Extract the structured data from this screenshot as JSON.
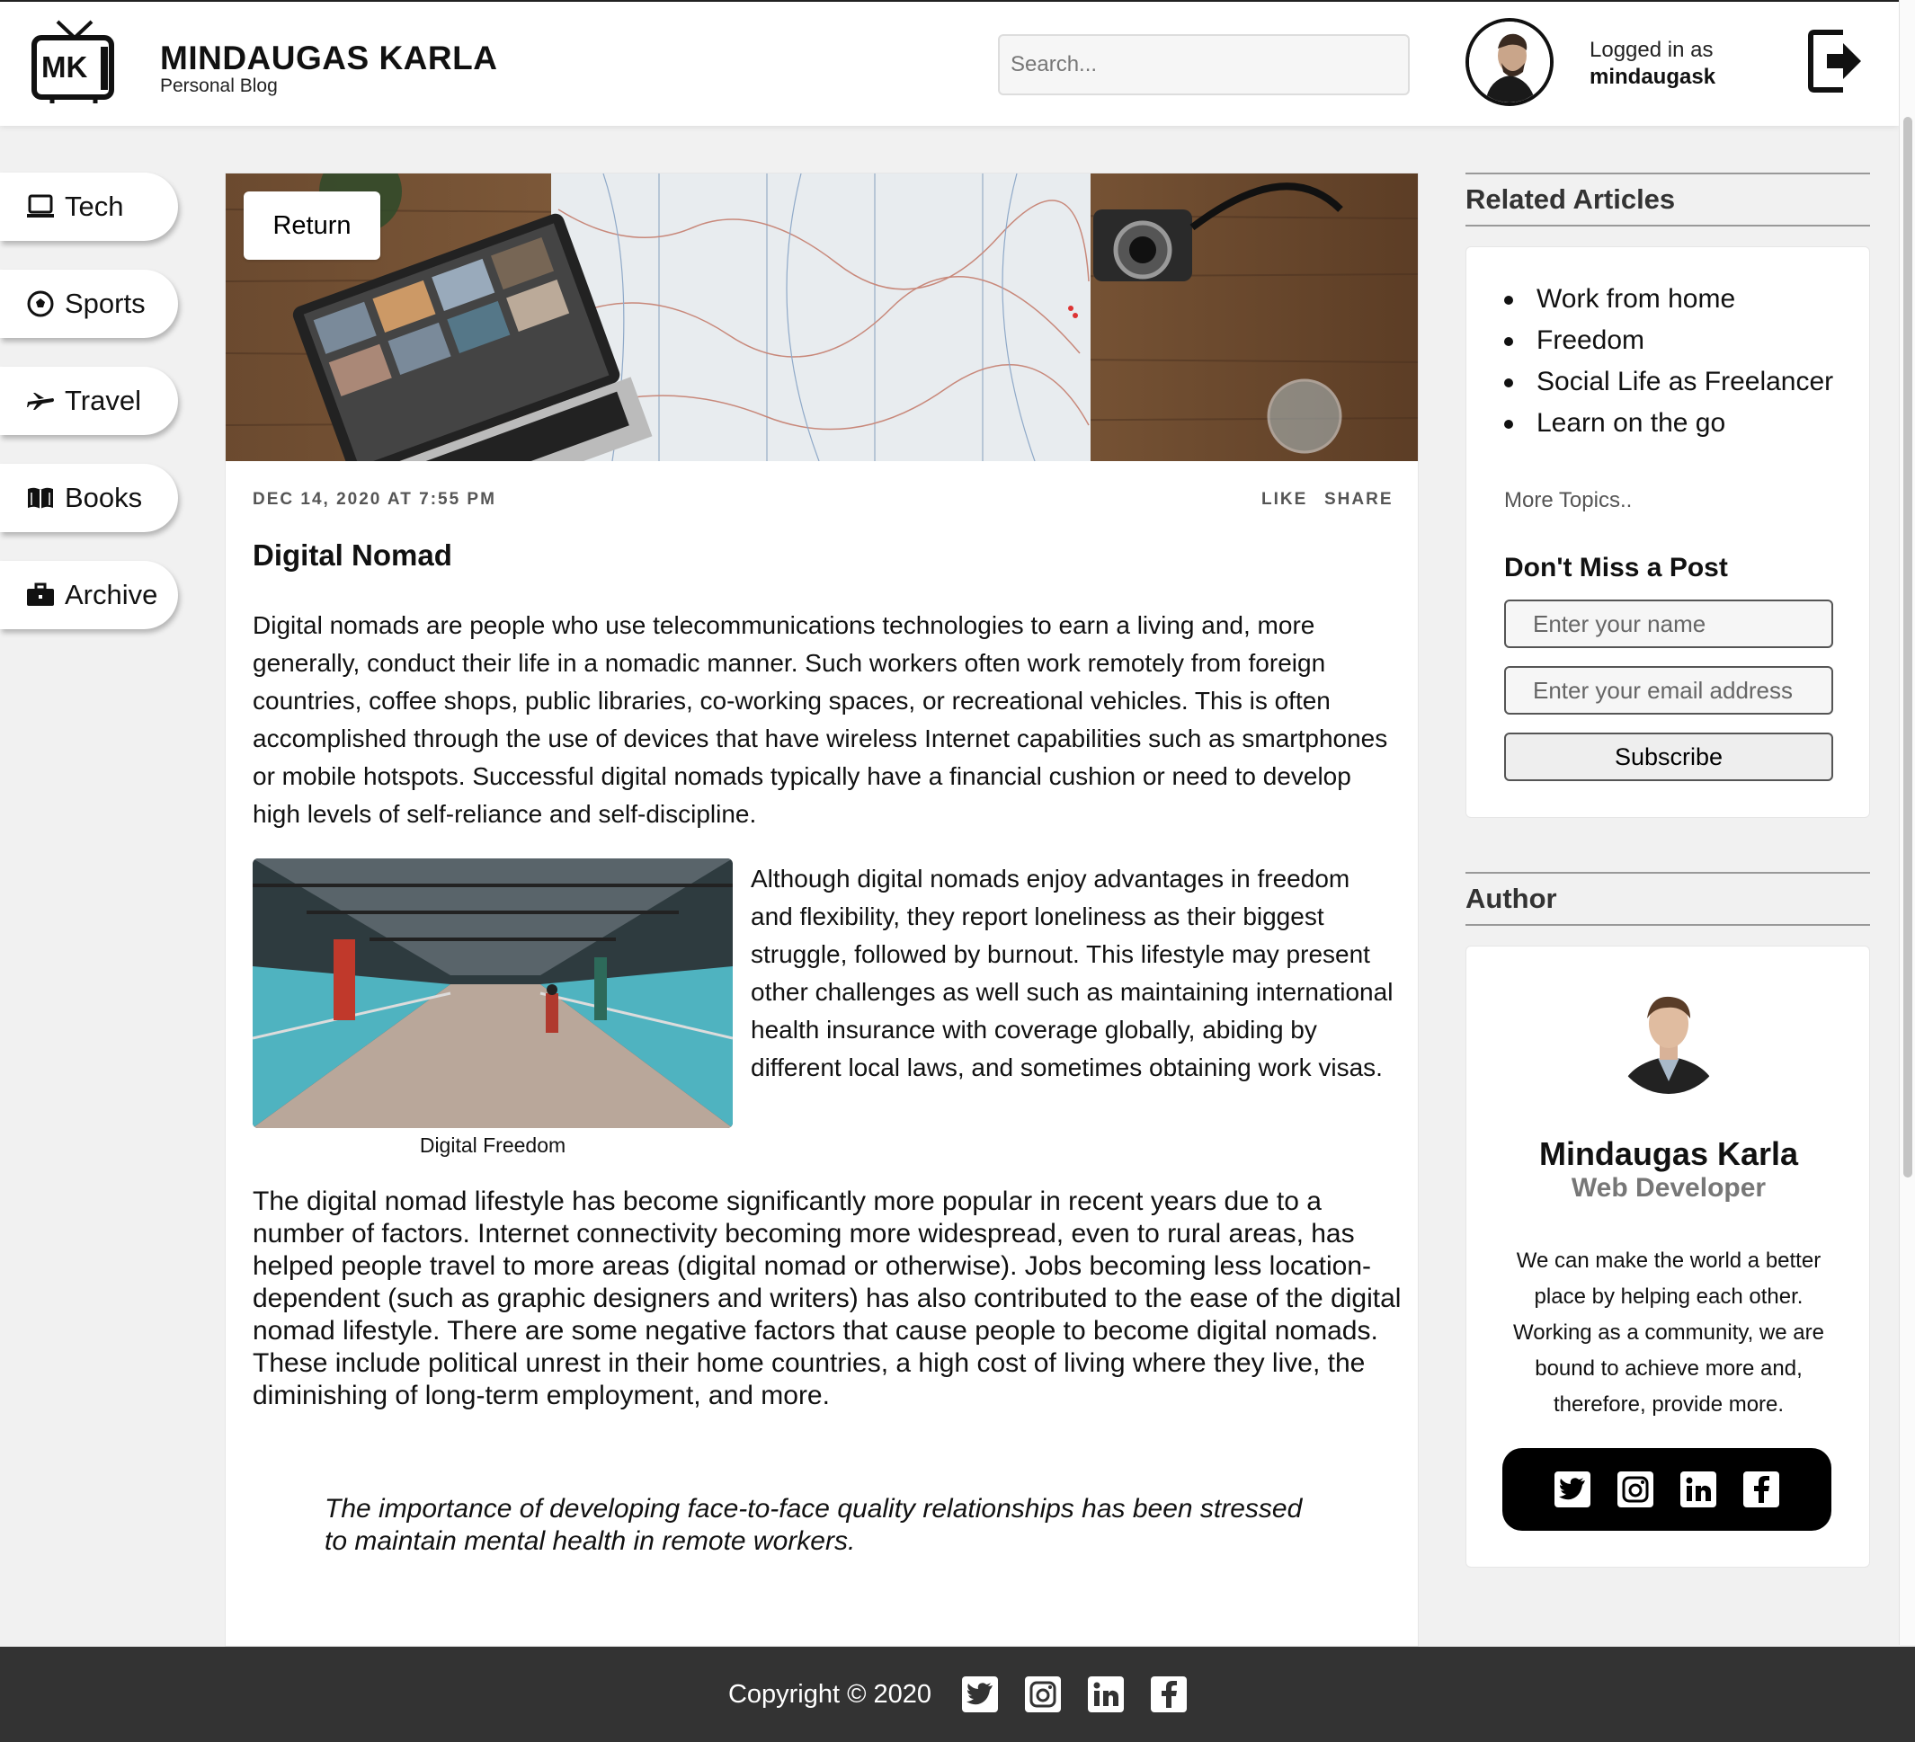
{
  "header": {
    "logo_text": "MK",
    "brand_title": "MINDAUGAS KARLA",
    "brand_subtitle": "Personal Blog",
    "search_placeholder": "Search...",
    "logged_in_label": "Logged in as",
    "username": "mindaugask"
  },
  "nav": {
    "items": [
      {
        "label": "Tech",
        "icon": "laptop-icon"
      },
      {
        "label": "Sports",
        "icon": "soccer-ball-icon"
      },
      {
        "label": "Travel",
        "icon": "plane-icon"
      },
      {
        "label": "Books",
        "icon": "book-icon"
      },
      {
        "label": "Archive",
        "icon": "briefcase-icon"
      }
    ]
  },
  "article": {
    "return_label": "Return",
    "date": "DEC 14, 2020 AT 7:55 PM",
    "like_label": "LIKE",
    "share_label": "SHARE",
    "title": "Digital Nomad",
    "paragraph1": "Digital nomads are people who use telecommunications technologies to earn a living and, more generally, conduct their life in a nomadic manner. Such workers often work remotely from foreign countries, coffee shops, public libraries, co-working spaces, or recreational vehicles. This is often accomplished through the use of devices that have wireless Internet capabilities such as smartphones or mobile hotspots. Successful digital nomads typically have a financial cushion or need to develop high levels of self-reliance and self-discipline.",
    "figure_caption": "Digital Freedom",
    "paragraph2": "Although digital nomads enjoy advantages in freedom and flexibility, they report loneliness as their biggest struggle, followed by burnout. This lifestyle may present other challenges as well such as maintaining international health insurance with coverage globally, abiding by different local laws, and sometimes obtaining work visas.",
    "paragraph3": "The digital nomad lifestyle has become significantly more popular in recent years due to a number of factors. Internet connectivity becoming more widespread, even to rural areas, has helped people travel to more areas (digital nomad or otherwise). Jobs becoming less location-dependent (such as graphic designers and writers) has also contributed to the ease of the digital nomad lifestyle. There are some negative factors that cause people to become digital nomads. These include political unrest in their home countries, a high cost of living where they live, the diminishing of long-term employment, and more.",
    "quote": "The importance of developing face-to-face quality relationships has been stressed to maintain mental health in remote workers."
  },
  "sidebar": {
    "related_title": "Related Articles",
    "related_items": [
      "Work from home",
      "Freedom",
      "Social Life as Freelancer",
      "Learn on the go"
    ],
    "more_topics": "More Topics..",
    "newsletter_title": "Don't Miss a Post",
    "name_placeholder": "Enter your name",
    "email_placeholder": "Enter your email address",
    "subscribe_label": "Subscribe",
    "author_title": "Author",
    "author_name": "Mindaugas Karla",
    "author_role": "Web Developer",
    "author_bio": "We can make the world a better place by helping each other. Working as a community, we are bound to achieve more and, therefore, provide more.",
    "social_icons": [
      "twitter-icon",
      "instagram-icon",
      "linkedin-icon",
      "facebook-icon"
    ]
  },
  "footer": {
    "copyright": "Copyright © 2020",
    "social_icons": [
      "twitter-icon",
      "instagram-icon",
      "linkedin-icon",
      "facebook-icon"
    ]
  },
  "colors": {
    "page_bg": "#f1f1f1",
    "footer_bg": "#333333",
    "social_bar_bg": "#000000"
  }
}
